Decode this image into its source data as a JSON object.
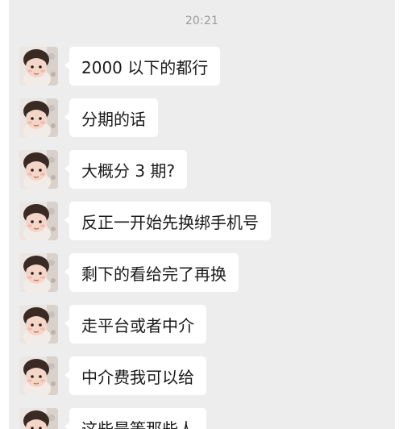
{
  "chat": {
    "timestamp": "20:21",
    "messages": [
      {
        "text": "2000 以下的都行",
        "avatar": "baby-avatar-icon"
      },
      {
        "text": "分期的话",
        "avatar": "baby-avatar-icon"
      },
      {
        "text": "大概分 3 期?",
        "avatar": "baby-avatar-icon"
      },
      {
        "text": "反正一开始先换绑手机号",
        "avatar": "baby-avatar-icon"
      },
      {
        "text": "剩下的看给完了再换",
        "avatar": "baby-avatar-icon"
      },
      {
        "text": "走平台或者中介",
        "avatar": "baby-avatar-icon"
      },
      {
        "text": "中介费我可以给",
        "avatar": "baby-avatar-icon"
      },
      {
        "text": "这些是等那些人",
        "avatar": "baby-avatar-icon"
      }
    ]
  },
  "colors": {
    "chat_background": "#ededed",
    "bubble": "#ffffff",
    "timestamp_text": "#9b9b9b",
    "message_text": "#1a1a1a"
  }
}
